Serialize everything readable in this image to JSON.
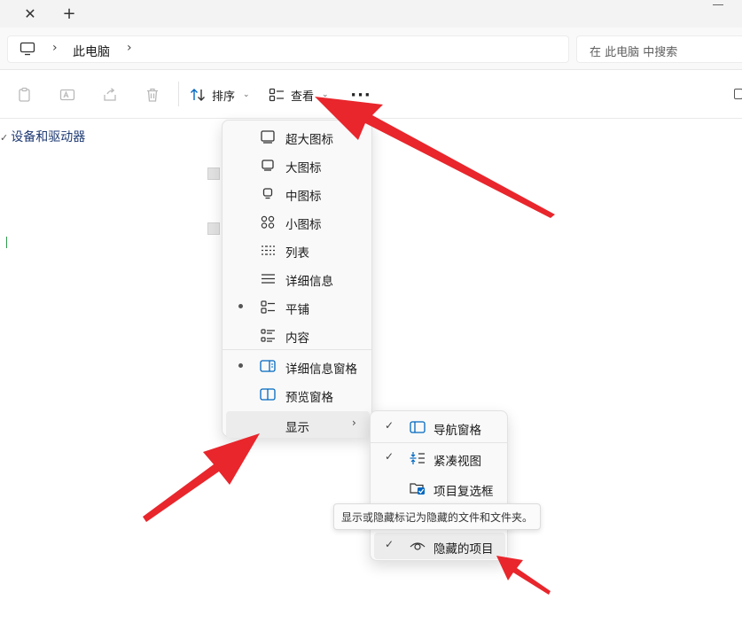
{
  "tabs": {
    "close_glyph": "✕",
    "new_glyph": "+"
  },
  "address": {
    "crumb": "此电脑",
    "search_placeholder": "在 此电脑 中搜索"
  },
  "toolbar": {
    "sort_label": "排序",
    "view_label": "查看",
    "more_label": "···"
  },
  "content": {
    "section_title": "设备和驱动器"
  },
  "view_menu": {
    "items": [
      {
        "label": "超大图标",
        "icon": "extra-large-icons-icon",
        "selected": false
      },
      {
        "label": "大图标",
        "icon": "large-icons-icon",
        "selected": false
      },
      {
        "label": "中图标",
        "icon": "medium-icons-icon",
        "selected": false
      },
      {
        "label": "小图标",
        "icon": "small-icons-icon",
        "selected": false
      },
      {
        "label": "列表",
        "icon": "list-icon",
        "selected": false
      },
      {
        "label": "详细信息",
        "icon": "details-icon",
        "selected": false
      },
      {
        "label": "平铺",
        "icon": "tiles-icon",
        "selected": true
      },
      {
        "label": "内容",
        "icon": "content-icon",
        "selected": false
      }
    ],
    "pane_items": [
      {
        "label": "详细信息窗格",
        "icon": "details-pane-icon",
        "selected": true
      },
      {
        "label": "预览窗格",
        "icon": "preview-pane-icon",
        "selected": false
      }
    ],
    "show_label": "显示"
  },
  "show_submenu": {
    "items": [
      {
        "label": "导航窗格",
        "checked": true,
        "icon": "navigation-pane-icon"
      },
      {
        "label": "紧凑视图",
        "checked": true,
        "icon": "compact-view-icon"
      },
      {
        "label": "项目复选框",
        "checked": false,
        "icon": "item-checkbox-icon"
      },
      {
        "label": "隐藏的项目",
        "checked": true,
        "icon": "hidden-items-icon"
      }
    ]
  },
  "tooltip": {
    "text": "显示或隐藏标记为隐藏的文件和文件夹。"
  },
  "colors": {
    "accent": "#0067c0",
    "annotation_red": "#e8262c",
    "section_title": "#1e3a73"
  }
}
